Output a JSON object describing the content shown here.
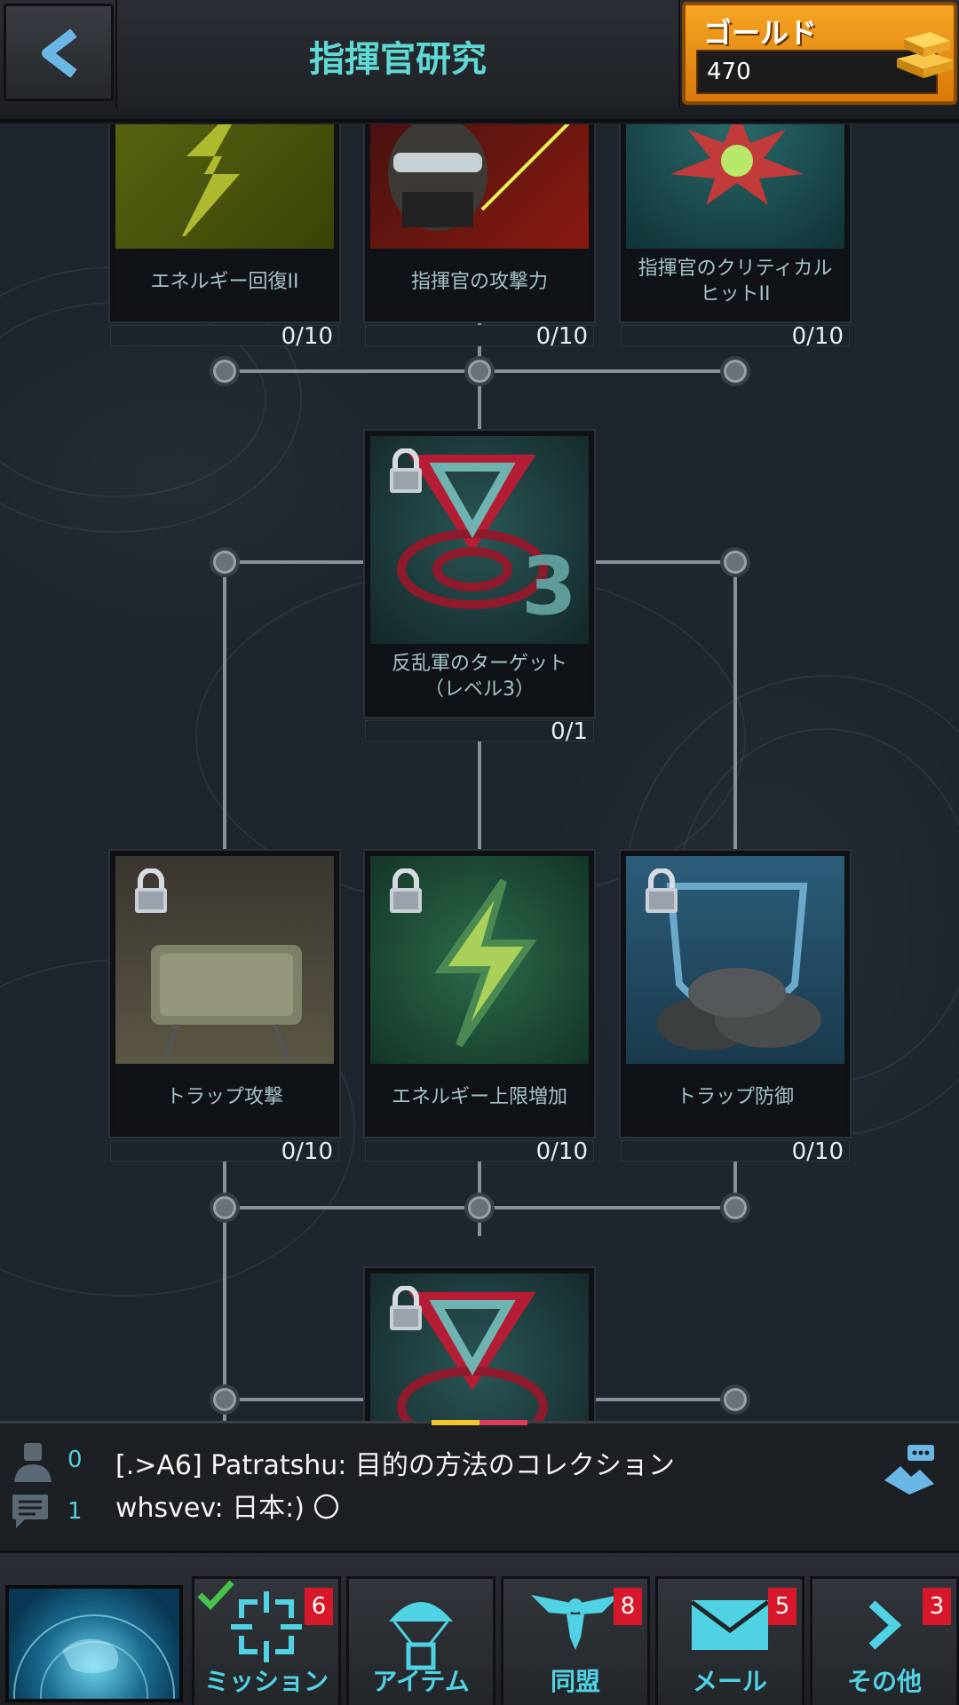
{
  "header": {
    "title": "指揮官研究",
    "gold": {
      "label": "ゴールド",
      "value": "470"
    }
  },
  "cards": [
    {
      "label": "エネルギー回復II",
      "count": "0/10",
      "locked": false
    },
    {
      "label": "指揮官の攻撃力",
      "count": "0/10",
      "locked": false
    },
    {
      "label": "指揮官のクリティカルヒットII",
      "count": "0/10",
      "locked": false
    },
    {
      "label": "反乱軍のターゲット（レベル3）",
      "count": "0/1",
      "locked": true
    },
    {
      "label": "トラップ攻撃",
      "count": "0/10",
      "locked": true
    },
    {
      "label": "エネルギー上限増加",
      "count": "0/10",
      "locked": true
    },
    {
      "label": "トラップ防御",
      "count": "0/10",
      "locked": true
    }
  ],
  "chat": {
    "online_count": "0",
    "message_count": "1",
    "messages": [
      "[.>A6] Patratshu: 目的の方法のコレクション",
      "whsvev: 日本:) 〇"
    ]
  },
  "nav": [
    {
      "label": "ミッション",
      "badge": "6",
      "icon": "target-icon"
    },
    {
      "label": "アイテム",
      "badge": "",
      "icon": "parachute-icon"
    },
    {
      "label": "同盟",
      "badge": "8",
      "icon": "eagle-icon"
    },
    {
      "label": "メール",
      "badge": "5",
      "icon": "mail-icon"
    },
    {
      "label": "その他",
      "badge": "3",
      "icon": "chevron-right-icon"
    }
  ],
  "colors": {
    "accent": "#5fd9d4",
    "gold": "#f6a623",
    "badge": "#d7182a"
  }
}
